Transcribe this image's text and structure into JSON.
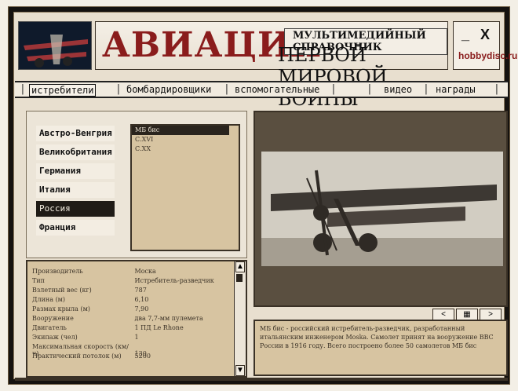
{
  "app": {
    "title": "АВИАЦИЯ",
    "subtitle_top": "МУЛЬТИМЕДИЙНЫЙ СПРАВОЧНИК",
    "subtitle_bottom": "ПЕРВОЙ МИРОВОЙ ВОЙНЫ",
    "brand": "hobbydisc.ru",
    "window_controls": {
      "minimize": "_",
      "close": "X"
    }
  },
  "nav": {
    "items": [
      {
        "label": "истребители",
        "active": true
      },
      {
        "label": "бомбардировщики",
        "active": false
      },
      {
        "label": "вспомогательные",
        "active": false
      },
      {
        "label": "видео",
        "active": false
      },
      {
        "label": "награды",
        "active": false
      }
    ]
  },
  "countries": [
    {
      "label": "Австро-Венгрия",
      "selected": false
    },
    {
      "label": "Великобритания",
      "selected": false
    },
    {
      "label": "Германия",
      "selected": false
    },
    {
      "label": "Италия",
      "selected": false
    },
    {
      "label": "Россия",
      "selected": true
    },
    {
      "label": "Франция",
      "selected": false
    }
  ],
  "aircraft": [
    {
      "label": "МБ бис",
      "selected": true
    },
    {
      "label": "С.XVI",
      "selected": false
    },
    {
      "label": "С.XX",
      "selected": false
    }
  ],
  "specs": [
    {
      "label": "Производитель",
      "value": "Моска"
    },
    {
      "label": "Тип",
      "value": "Истребитель-разведчик"
    },
    {
      "label": "Взлетный вес (кг)",
      "value": "787"
    },
    {
      "label": "Длина (м)",
      "value": "6,10"
    },
    {
      "label": "Размах крыла (м)",
      "value": "7,90"
    },
    {
      "label": "Вооружение",
      "value": "два 7,7-мм пулемета"
    },
    {
      "label": "Двигатель",
      "value": "1 ПД Le Rhone"
    },
    {
      "label": "Экипаж (чел)",
      "value": "1"
    },
    {
      "label": "Максимальная скорость (км/ч)",
      "value": "130"
    },
    {
      "label": "Практический потолок (м)",
      "value": "5200"
    }
  ],
  "description": "МБ бис - российский истребитель-разведчик, разработанный итальянским инженером Moska. Самолет принят на вооружение ВВС России в 1916 году. Всего построено более 50 самолетов МБ бис",
  "image_controls": {
    "prev": "<",
    "gallery": "▦",
    "next": ">"
  },
  "scrollbar": {
    "up": "▲",
    "down": "▼"
  }
}
